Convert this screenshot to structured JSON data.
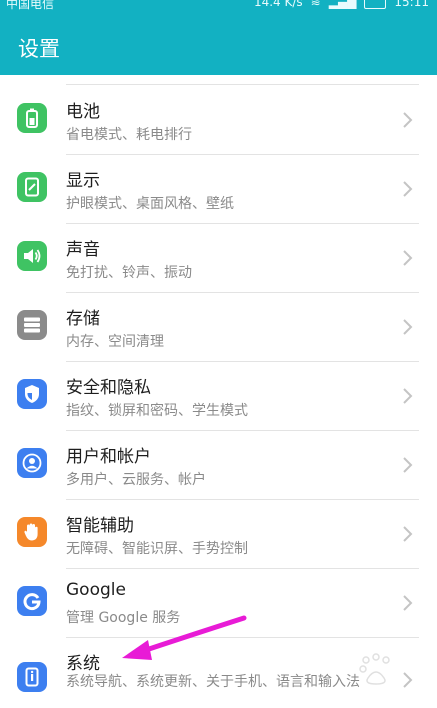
{
  "status_bar": {
    "carrier": "中国电信",
    "speed": "14.4 K/s",
    "time": "15:11"
  },
  "header": {
    "title": "设置"
  },
  "colors": {
    "accent": "#12b1c2",
    "annotation_arrow": "#e81bd6"
  },
  "items": [
    {
      "label": "电池",
      "sub": "省电模式、耗电排行",
      "icon": "battery-icon",
      "color": "#3fc363"
    },
    {
      "label": "显示",
      "sub": "护眼模式、桌面风格、壁纸",
      "icon": "display-icon",
      "color": "#3fc363"
    },
    {
      "label": "声音",
      "sub": "免打扰、铃声、振动",
      "icon": "sound-icon",
      "color": "#3fc363"
    },
    {
      "label": "存储",
      "sub": "内存、空间清理",
      "icon": "storage-icon",
      "color": "#8b8b8b"
    },
    {
      "label": "安全和隐私",
      "sub": "指纹、锁屏和密码、学生模式",
      "icon": "shield-icon",
      "color": "#3d7ff0"
    },
    {
      "label": "用户和帐户",
      "sub": "多用户、云服务、帐户",
      "icon": "user-icon",
      "color": "#3d7ff0"
    },
    {
      "label": "智能辅助",
      "sub": "无障碍、智能识屏、手势控制",
      "icon": "hand-icon",
      "color": "#f5882a"
    },
    {
      "label": "Google",
      "sub": "管理 Google 服务",
      "icon": "google-icon",
      "color": "#3d7ff0"
    },
    {
      "label": "系统",
      "sub": "系统导航、系统更新、关于手机、语言和输入法",
      "icon": "phone-icon",
      "color": "#3d7ff0"
    }
  ]
}
